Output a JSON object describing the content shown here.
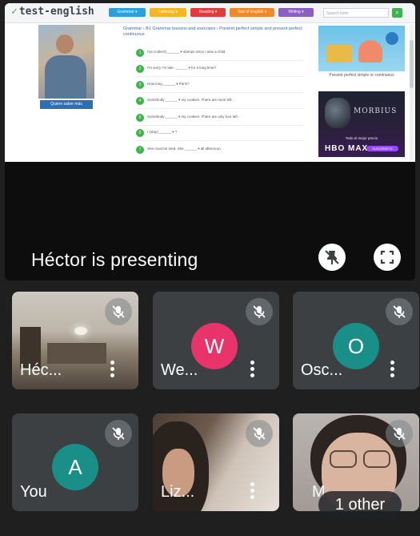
{
  "website": {
    "logo": "test-english",
    "nav": [
      {
        "label": "Grammar ▾",
        "color": "#2aa1d8"
      },
      {
        "label": "Listening ▾",
        "color": "#f2b824"
      },
      {
        "label": "Reading ▾",
        "color": "#e23b3b"
      },
      {
        "label": "Test of English ▾",
        "color": "#f0892a"
      },
      {
        "label": "Writing ▾",
        "color": "#8b5fbf"
      }
    ],
    "search_placeholder": "Search here",
    "breadcrumb": "Grammar › B1 Grammar lessons and exercises › Present perfect simple and present perfect continuous",
    "sidebar_ad_button": "Quiero saber más",
    "exercises": [
      {
        "n": "1",
        "text": "I've (collect) ______ ▾ stamps since I was a child."
      },
      {
        "n": "2",
        "text": "I'm sorry I'm late. ______ ▾ for a long time?"
      },
      {
        "n": "3",
        "text": "How long ______ ▾ Paris?"
      },
      {
        "n": "4",
        "text": "Somebody ______ ▾ my cookies. There are none left."
      },
      {
        "n": "5",
        "text": "Somebody ______ ▾ my cookies. There are only four left."
      },
      {
        "n": "6",
        "text": "I (stay) ______ ▾ ?"
      },
      {
        "n": "7",
        "text": "She must be tired. She ______ ▾ all afternoon."
      }
    ],
    "right_ad_caption": "Present perfect simple or continuous",
    "movie_ad": {
      "title": "MORBIUS",
      "promo": "Todo el mejor precio",
      "brand": "HBO MAX",
      "cta": "SUSCRÍBETE"
    }
  },
  "presentation": {
    "label": "Héctor  is presenting",
    "pin_icon": "unpin-icon",
    "fullscreen_icon": "fullscreen-icon"
  },
  "participants": [
    {
      "name": "Héc...",
      "type": "video",
      "muted": true
    },
    {
      "name": "We...",
      "type": "avatar",
      "initial": "W",
      "color": "#e8336b",
      "muted": true
    },
    {
      "name": "Osc...",
      "type": "avatar",
      "initial": "O",
      "color": "#1a8f88",
      "muted": true
    },
    {
      "name": "You",
      "type": "avatar",
      "initial": "A",
      "color": "#1a8f88",
      "muted": true
    },
    {
      "name": "Liz...",
      "type": "video",
      "muted": true
    },
    {
      "name": "M",
      "type": "video",
      "muted": true
    }
  ],
  "others_count_label": "1 other"
}
